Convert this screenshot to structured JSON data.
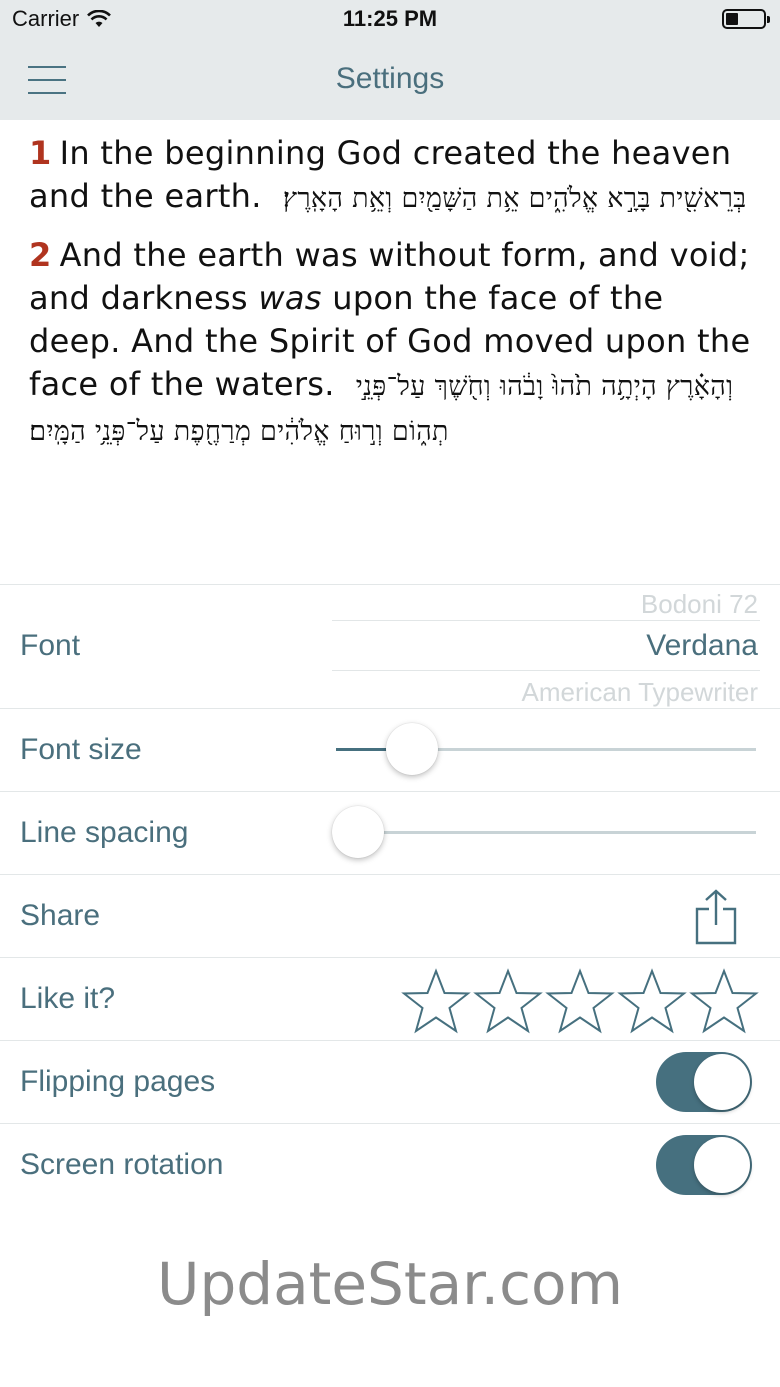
{
  "status_bar": {
    "carrier": "Carrier",
    "time": "11:25 PM"
  },
  "nav": {
    "title": "Settings"
  },
  "verses": [
    {
      "number": "1",
      "text": "In the beginning God created the heaven and the earth.",
      "hebrew": "בְּרֵאשִׁ֖ית בָּרָ֣א אֱלֹהִ֑ים אֵ֥ת הַשָּׁמַ֖יִם וְאֵ֥ת הָאָֽרֶץ׃"
    },
    {
      "number": "2",
      "text_before": "And the earth was without form, and void; and darkness",
      "text_italic": "was",
      "text_after": "upon the face of the deep. And the Spirit of God moved upon the face of the waters.",
      "hebrew": "וְהָאָ֗רֶץ הָיְתָ֥ה תֹ֙הוּ֙ וָבֹ֔הוּ וְחֹ֖שֶׁךְ עַל־פְּנֵ֣י תְה֑וֹם וְר֣וּחַ אֱלֹהִ֔ים מְרַחֶ֖פֶת עַל־פְּנֵ֥י הַמָּֽיִם׃"
    }
  ],
  "settings": {
    "font": {
      "label": "Font",
      "options_above": "Bodoni 72",
      "selected": "Verdana",
      "options_below": "American Typewriter"
    },
    "font_size": {
      "label": "Font size",
      "value": 0.18
    },
    "line_spacing": {
      "label": "Line spacing",
      "value": 0.0
    },
    "share": {
      "label": "Share",
      "icon": "share-icon"
    },
    "like": {
      "label": "Like it?",
      "stars_filled": 0,
      "stars_total": 5
    },
    "flipping_pages": {
      "label": "Flipping pages",
      "on": true
    },
    "screen_rotation": {
      "label": "Screen rotation",
      "on": true
    }
  },
  "colors": {
    "accent": "#46707f",
    "label": "#4a6f7d",
    "verse_number": "#b0341f",
    "bar_background": "#e6eaeb"
  },
  "watermark": "UpdateStar.com"
}
